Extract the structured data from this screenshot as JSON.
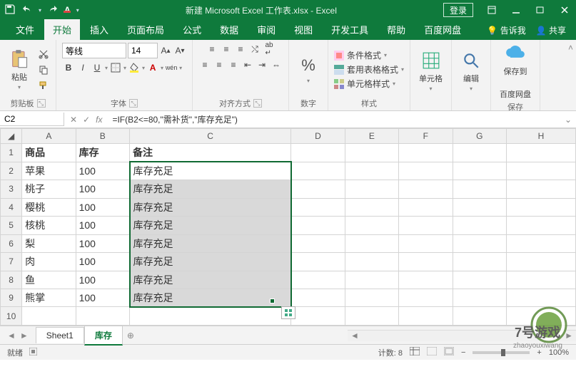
{
  "title": "新建 Microsoft Excel 工作表.xlsx - Excel",
  "login": "登录",
  "tabs": [
    "文件",
    "开始",
    "插入",
    "页面布局",
    "公式",
    "数据",
    "审阅",
    "视图",
    "开发工具",
    "帮助",
    "百度网盘"
  ],
  "tellme": "告诉我",
  "share": "共享",
  "groups": {
    "clipboard": "剪贴板",
    "paste": "粘贴",
    "font": "字体",
    "fontname": "等线",
    "fontsize": "14",
    "align": "对齐方式",
    "number": "数字",
    "numbtn": "%",
    "styles": "样式",
    "style_cond": "条件格式",
    "style_table": "套用表格格式",
    "style_cell": "单元格样式",
    "cells": "单元格",
    "edit": "编辑",
    "save": "保存",
    "save_to": "保存到",
    "save_cloud": "百度网盘"
  },
  "namebox": "C2",
  "formula": "=IF(B2<=80,\"需补货\",\"库存充足\")",
  "cols": [
    "A",
    "B",
    "C",
    "D",
    "E",
    "F",
    "G",
    "H"
  ],
  "header": {
    "a": "商品",
    "b": "库存",
    "c": "备注"
  },
  "rows": [
    {
      "a": "苹果",
      "b": "100",
      "c": "库存充足"
    },
    {
      "a": "桃子",
      "b": "100",
      "c": "库存充足"
    },
    {
      "a": "樱桃",
      "b": "100",
      "c": "库存充足"
    },
    {
      "a": "核桃",
      "b": "100",
      "c": "库存充足"
    },
    {
      "a": "梨",
      "b": "100",
      "c": "库存充足"
    },
    {
      "a": "肉",
      "b": "100",
      "c": "库存充足"
    },
    {
      "a": "鱼",
      "b": "100",
      "c": "库存充足"
    },
    {
      "a": "熊掌",
      "b": "100",
      "c": "库存充足"
    }
  ],
  "sheets": [
    "Sheet1",
    "库存"
  ],
  "active_sheet": 1,
  "status": {
    "ready": "就绪",
    "count_lbl": "计数:",
    "count": "8",
    "zoom": "100%"
  },
  "watermark": {
    "t1": "7号游戏",
    "t2": "zhaoyouxiwang"
  }
}
